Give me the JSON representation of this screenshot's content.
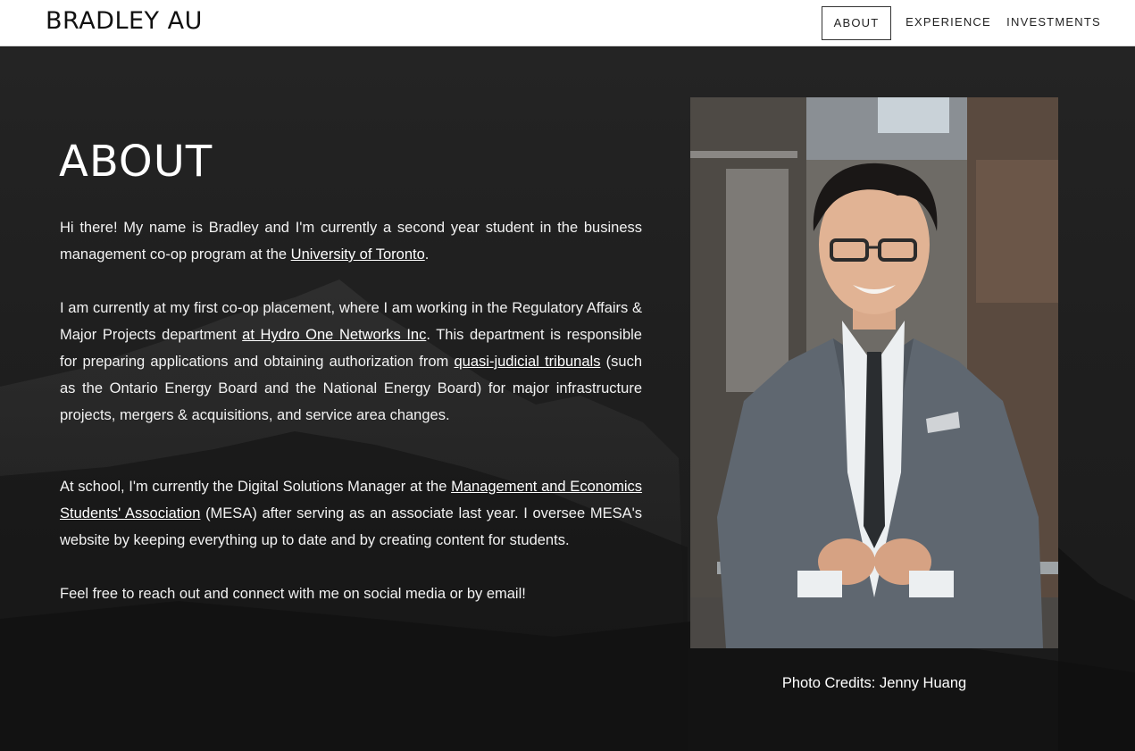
{
  "header": {
    "brand": "BRADLEY AU",
    "nav": [
      {
        "label": "ABOUT",
        "active": true
      },
      {
        "label": "EXPERIENCE",
        "active": false
      },
      {
        "label": "INVESTMENTS",
        "active": false
      }
    ]
  },
  "about": {
    "title": "ABOUT",
    "p1_a": "Hi there! My name is Bradley and I'm currently a second year student in the business management co-op program at the ",
    "p1_link": "University of Toronto",
    "p1_b": ".",
    "p2_a": "I am currently at my first co-op placement, where I am working in the Regulatory Affairs & Major Projects department ",
    "p2_link1": "at Hydro One Networks Inc",
    "p2_b": ". This department is responsible for preparing applications and obtaining authorization from ",
    "p2_link2": "quasi-judicial tribunals",
    "p2_c": " (such as the Ontario Energy Board and the National Energy Board) for major infrastructure projects, mergers & acquisitions, and service area changes.",
    "p3_a": "At school, I'm currently the Digital Solutions Manager at the ",
    "p3_link": "Management and Economics Students' Association",
    "p3_b": " (MESA) after serving as an associate last year. I oversee MESA's website by keeping everything up to date and by creating content for students.",
    "p4": "Feel free to reach out and connect with me on social media or by email!"
  },
  "photo": {
    "credit": "Photo Credits: Jenny Huang"
  },
  "colors": {
    "background": "#1c1c1c",
    "header": "#ffffff",
    "text": "#f2f2f2"
  }
}
